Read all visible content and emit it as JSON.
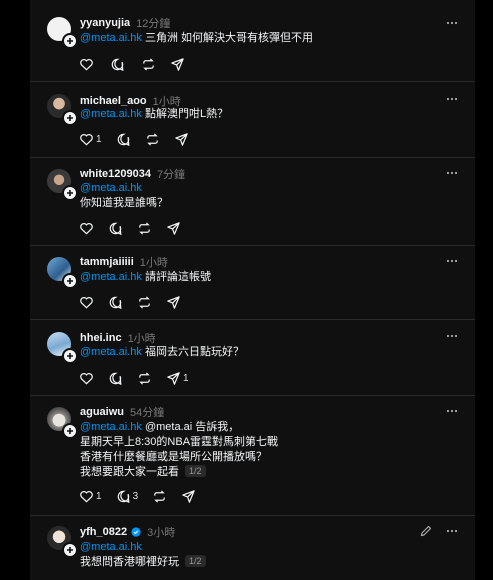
{
  "posts": [
    {
      "username": "yyanyujia",
      "time": "12分鐘",
      "avatar": "blank",
      "lines": [
        {
          "mention": "@meta.ai.hk",
          "text": " 三角洲 如何解決大哥有核彈但不用"
        }
      ],
      "like_count": "",
      "comment_count": "",
      "share_count": ""
    },
    {
      "username": "michael_aoo",
      "time": "1小時",
      "avatar": "photo-dark",
      "lines": [
        {
          "mention": "@meta.ai.hk",
          "text": " 點解澳門咁L熱？"
        }
      ],
      "like_count": "1",
      "comment_count": "",
      "share_count": ""
    },
    {
      "username": "white1209034",
      "time": "7分鐘",
      "avatar": "photo-dark",
      "lines": [
        {
          "mention": "@meta.ai.hk",
          "text": ""
        },
        {
          "mention": "",
          "text": "你知道我是誰嗎？"
        }
      ],
      "like_count": "",
      "comment_count": "",
      "share_count": ""
    },
    {
      "username": "tammjaiiiii",
      "time": "1小時",
      "avatar": "photo-blue",
      "lines": [
        {
          "mention": "@meta.ai.hk",
          "text": " 請評論這帳號"
        }
      ],
      "like_count": "",
      "comment_count": "",
      "share_count": ""
    },
    {
      "username": "hhei.inc",
      "time": "1小時",
      "avatar": "photo-sky",
      "lines": [
        {
          "mention": "@meta.ai.hk",
          "text": " 福岡去六日點玩好？"
        }
      ],
      "like_count": "",
      "comment_count": "",
      "share_count": "1"
    },
    {
      "username": "aguaiwu",
      "time": "54分鐘",
      "avatar": "photo-dog",
      "lines": [
        {
          "mention": "@meta.ai.hk",
          "text": " @meta.ai 告訴我，"
        },
        {
          "mention": "",
          "text": "星期天早上8:30的NBA雷霆對馬刺第七戰"
        },
        {
          "mention": "",
          "text": "香港有什麼餐廳或是場所公開播放嗎？"
        },
        {
          "mention": "",
          "text": "我想要跟大家一起看"
        }
      ],
      "pager": "1/2",
      "like_count": "1",
      "comment_count": "3",
      "share_count": ""
    },
    {
      "username": "yfh_0822",
      "time": "3小時",
      "avatar": "photo-face",
      "verified": true,
      "lines": [
        {
          "mention": "@meta.ai.hk",
          "text": ""
        },
        {
          "mention": "",
          "text": "我想問香港哪裡好玩"
        }
      ],
      "pager": "1/2"
    }
  ],
  "colors": {
    "background": "#101010",
    "mention": "#0095f6",
    "verified": "#0095f6"
  }
}
